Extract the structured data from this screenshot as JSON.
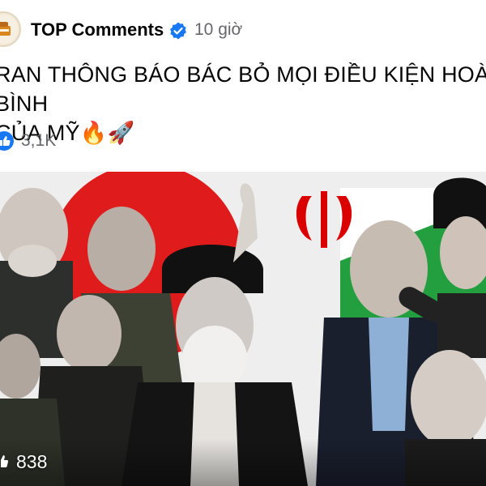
{
  "post": {
    "page_name": "TOP Comments",
    "time": "10 giờ",
    "text": "RAN THÔNG BÁO BÁC BỎ MỌI ĐIỀU KIỆN HOÀ BÌNH\nCỦA MỸ🔥🚀",
    "reaction_count": "3,1K",
    "photo_overlay_count": "838",
    "avatar_icon": "page-logo-icon",
    "verified_icon": "verified-badge-icon",
    "reaction_icon": "like-reaction-icon",
    "overlay_icon": "like-reaction-icon"
  },
  "colors": {
    "verified": "#1877f2",
    "flag_red": "#da0000",
    "flag_green": "#239f40"
  }
}
